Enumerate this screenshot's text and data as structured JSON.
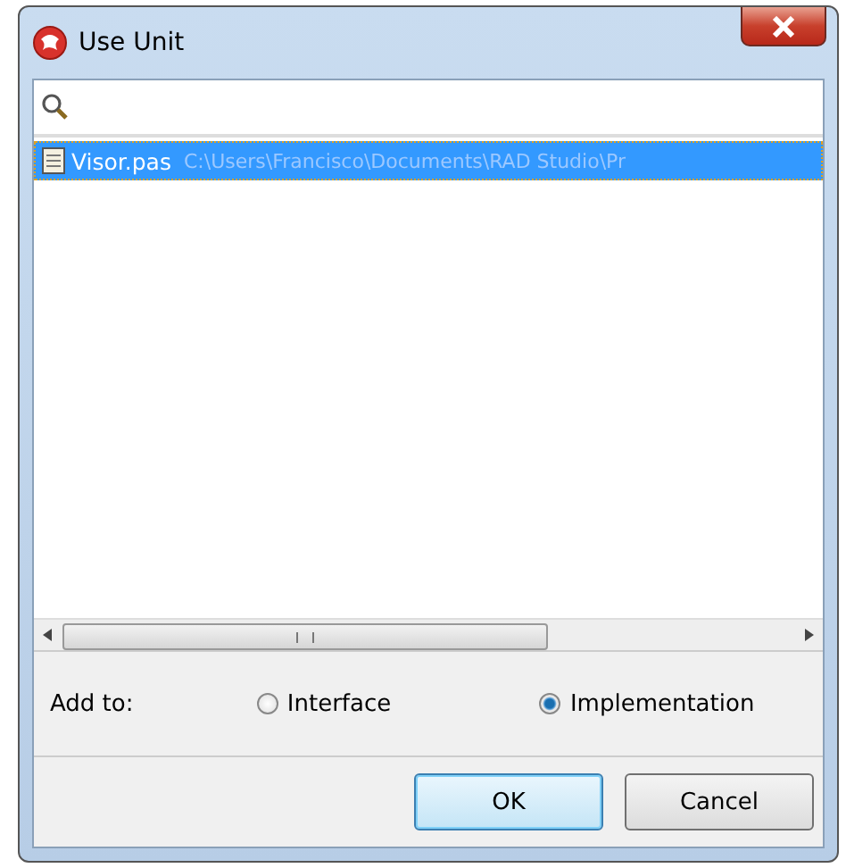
{
  "window": {
    "title": "Use Unit"
  },
  "units": [
    {
      "name": "Visor.pas",
      "path": "C:\\Users\\Francisco\\Documents\\RAD Studio\\Pr",
      "selected": true
    }
  ],
  "add_to": {
    "label": "Add to:",
    "options": [
      {
        "label": "Interface",
        "selected": false
      },
      {
        "label": "Implementation",
        "selected": true
      }
    ]
  },
  "buttons": [
    {
      "label": "OK",
      "kind": "default"
    },
    {
      "label": "Cancel",
      "kind": "normal"
    }
  ]
}
